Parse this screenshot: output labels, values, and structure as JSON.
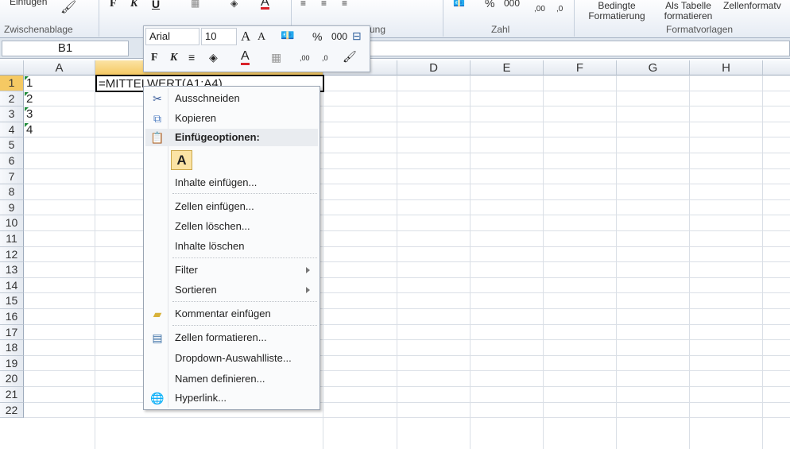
{
  "ribbon": {
    "clipboard": {
      "paste_label": "Einfügen",
      "group_label": "Zwischenablage"
    },
    "font": {
      "bold": "F",
      "italic": "K",
      "underline": "U"
    },
    "alignment": {
      "group_label": "ung"
    },
    "number": {
      "group_label": "Zahl",
      "percent": "%",
      "thousands": "000",
      "inc_decimal": ",00",
      "dec_decimal": ",0"
    },
    "styles": {
      "conditional_l1": "Bedingte",
      "conditional_l2": "Formatierung",
      "table_l1": "Als Tabelle",
      "table_l2": "formatieren",
      "cellstyles_l1": "Zellenformatv",
      "group_label": "Formatvorlagen"
    }
  },
  "formula_bar": {
    "name_box": "B1"
  },
  "grid": {
    "columns": [
      "A",
      "B",
      "C",
      "D",
      "E",
      "F",
      "G",
      "H"
    ],
    "selected_column": "B",
    "rows": [
      "1",
      "2",
      "3",
      "4",
      "5",
      "6",
      "7",
      "8",
      "9",
      "10",
      "11",
      "12",
      "13",
      "14",
      "15",
      "16",
      "17",
      "18",
      "19",
      "20",
      "21",
      "22"
    ],
    "cells": {
      "A1": "1",
      "A2": "2",
      "A3": "3",
      "A4": "4",
      "B1": "=MITTELWERT(A1:A4)"
    }
  },
  "mini_toolbar": {
    "font": "Arial",
    "size": "10",
    "grow": "A",
    "shrink": "A",
    "percent": "%",
    "thousands": "000",
    "bold": "F",
    "italic": "K",
    "inc_decimal": ",00",
    "dec_decimal": ",0"
  },
  "context_menu": {
    "items": [
      {
        "label": "Ausschneiden",
        "icon": "scissors-icon"
      },
      {
        "label": "Kopieren",
        "icon": "copy-icon"
      },
      {
        "label": "Einfügeoptionen:",
        "icon": "paste-icon"
      },
      {
        "label": "A",
        "icon": "paste-values-icon"
      },
      {
        "label": "Inhalte einfügen..."
      },
      {
        "label": "Zellen einfügen..."
      },
      {
        "label": "Zellen löschen..."
      },
      {
        "label": "Inhalte löschen"
      },
      {
        "label": "Filter"
      },
      {
        "label": "Sortieren"
      },
      {
        "label": "Kommentar einfügen",
        "icon": "comment-icon"
      },
      {
        "label": "Zellen formatieren...",
        "icon": "format-cells-icon"
      },
      {
        "label": "Dropdown-Auswahlliste..."
      },
      {
        "label": "Namen definieren..."
      },
      {
        "label": "Hyperlink...",
        "icon": "hyperlink-icon"
      }
    ]
  },
  "colors": {
    "selection_header": "#f5c963",
    "ribbon": "#e6ecf4",
    "font_color_bar": "#d9232a"
  }
}
